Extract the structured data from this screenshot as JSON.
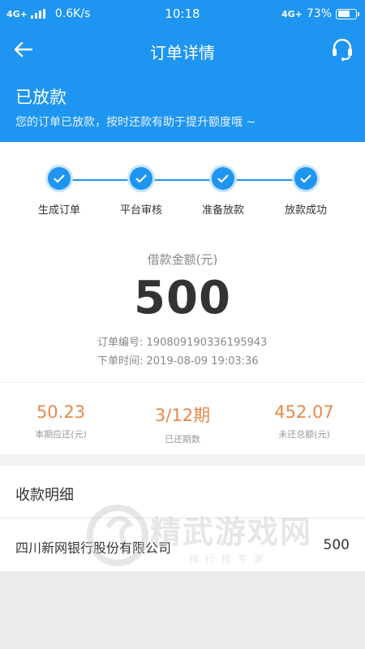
{
  "status_bar": {
    "network_left": "4G+",
    "speed": "0.6K/s",
    "time": "10:18",
    "network_right": "4G+",
    "battery": "73%",
    "battery_level": 0.73
  },
  "header": {
    "title": "订单详情",
    "back_icon": "back-arrow-icon",
    "service_icon": "headset-icon"
  },
  "order_status": {
    "title": "已放款",
    "description": "您的订单已放款，按时还款有助于提升额度哦 ~"
  },
  "progress_steps": [
    {
      "label": "生成订单",
      "done": true
    },
    {
      "label": "平台审核",
      "done": true
    },
    {
      "label": "准备放款",
      "done": true
    },
    {
      "label": "放款成功",
      "done": true
    }
  ],
  "loan": {
    "amount_label": "借款金额(元)",
    "amount": "500",
    "order_no_label": "订单编号:",
    "order_no": "190809190336195943",
    "order_time_label": "下单时间:",
    "order_time": "2019-08-09 19:03:36"
  },
  "summary": [
    {
      "value": "50.23",
      "label": "本期应还(元)"
    },
    {
      "value": "3/12期",
      "label": "已还期数"
    },
    {
      "value": "452.07",
      "label": "未还总额(元)"
    }
  ],
  "receipt": {
    "section_title": "收款明细",
    "payee": "四川新网银行股份有限公司",
    "amount": "500"
  },
  "watermark": {
    "text": "精武游戏网",
    "sub": "排行榜专家"
  },
  "colors": {
    "primary": "#1e95f0",
    "accent": "#e6894a"
  }
}
